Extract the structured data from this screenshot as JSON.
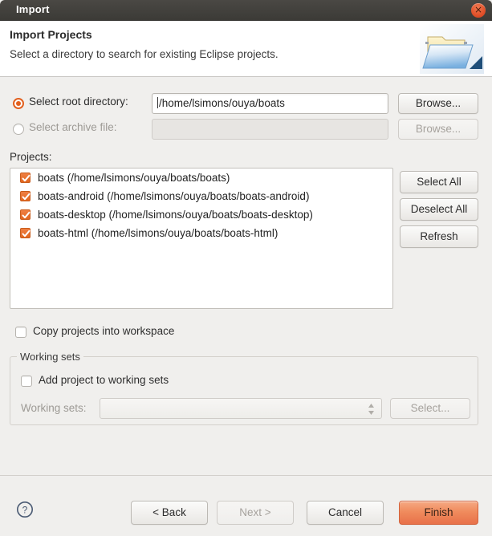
{
  "window": {
    "title": "Import",
    "close_label": "×"
  },
  "header": {
    "title": "Import Projects",
    "subtitle": "Select a directory to search for existing Eclipse projects.",
    "icon": "open-folder-icon"
  },
  "source": {
    "root_radio_label": "Select root directory:",
    "root_value": "/home/lsimons/ouya/boats",
    "root_browse_label": "Browse...",
    "archive_radio_label": "Select archive file:",
    "archive_value": "",
    "archive_browse_label": "Browse...",
    "selected": "root"
  },
  "projects": {
    "label": "Projects:",
    "items": [
      {
        "name": "boats (/home/lsimons/ouya/boats/boats)",
        "checked": true
      },
      {
        "name": "boats-android (/home/lsimons/ouya/boats/boats-android)",
        "checked": true
      },
      {
        "name": "boats-desktop (/home/lsimons/ouya/boats/boats-desktop)",
        "checked": true
      },
      {
        "name": "boats-html (/home/lsimons/ouya/boats/boats-html)",
        "checked": true
      }
    ],
    "select_all_label": "Select All",
    "deselect_all_label": "Deselect All",
    "refresh_label": "Refresh"
  },
  "options": {
    "copy_label": "Copy projects into workspace",
    "copy_checked": false
  },
  "working_sets": {
    "group_label": "Working sets",
    "add_label": "Add project to working sets",
    "add_checked": false,
    "combo_label": "Working sets:",
    "combo_value": "",
    "select_label": "Select..."
  },
  "footer": {
    "help_label": "?",
    "back_label": "< Back",
    "next_label": "Next >",
    "cancel_label": "Cancel",
    "finish_label": "Finish"
  },
  "colors": {
    "accent": "#e2601f",
    "titlebar": "#3b3a36",
    "body": "#f0efed",
    "finish": "#e8714a"
  }
}
